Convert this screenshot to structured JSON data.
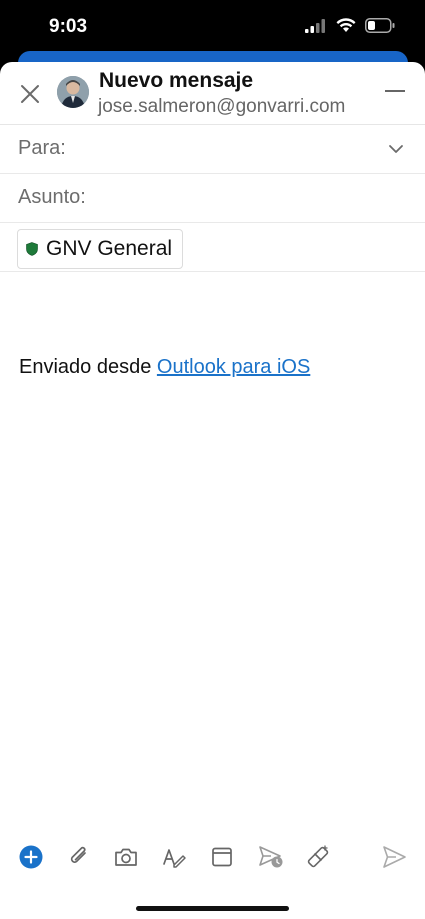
{
  "status_bar": {
    "time": "9:03"
  },
  "header": {
    "title": "Nuevo mensaje",
    "account": "jose.salmeron@gonvarri.com"
  },
  "fields": {
    "to_label": "Para:",
    "subject_label": "Asunto:"
  },
  "sensitivity": {
    "label": "GNV General",
    "color": "#1e7a3a"
  },
  "body": {
    "prefix": "Enviado desde ",
    "link": "Outlook para iOS"
  },
  "toolbar": {
    "icons": [
      "add-icon",
      "attach-icon",
      "camera-icon",
      "format-icon",
      "calendar-icon",
      "schedule-send-icon",
      "magic-icon",
      "send-icon"
    ]
  },
  "colors": {
    "accent": "#1a72c9",
    "brand_blue": "#1865c7"
  }
}
